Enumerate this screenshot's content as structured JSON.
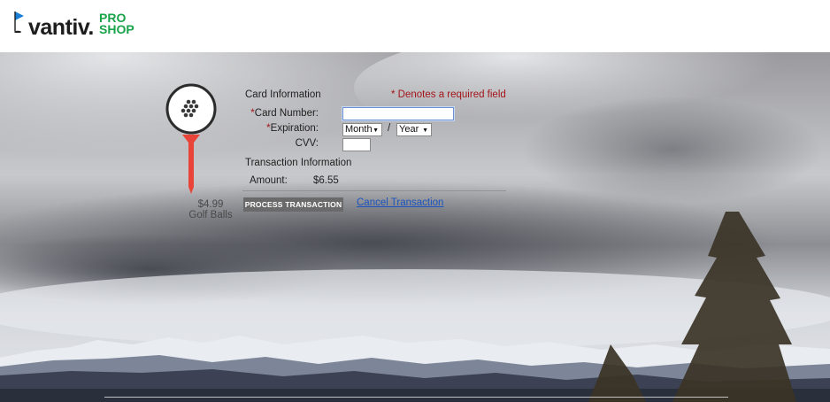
{
  "header": {
    "logo_word": "vantiv.",
    "logo_pro": "PRO",
    "logo_shop": "SHOP"
  },
  "product": {
    "price": "$4.99",
    "name": "Golf Balls"
  },
  "form": {
    "card_info_title": "Card Information",
    "required_note": "* Denotes a required field",
    "card_number_label": "Card Number:",
    "expiration_label": "Expiration:",
    "cvv_label": "CVV:",
    "month_selected": "Month",
    "year_selected": "Year",
    "date_separator": "/",
    "transaction_title": "Transaction Information",
    "amount_label": "Amount:",
    "amount_value": "$6.55",
    "required_mark": "*"
  },
  "actions": {
    "process_label": "PROCESS TRANSACTION",
    "cancel_label": "Cancel Transaction"
  },
  "colors": {
    "brand_green": "#19a34a",
    "flag_blue": "#1a7fd4",
    "required_red": "#a3151a",
    "tee_red": "#e8443a",
    "link_blue": "#1c55c0"
  }
}
